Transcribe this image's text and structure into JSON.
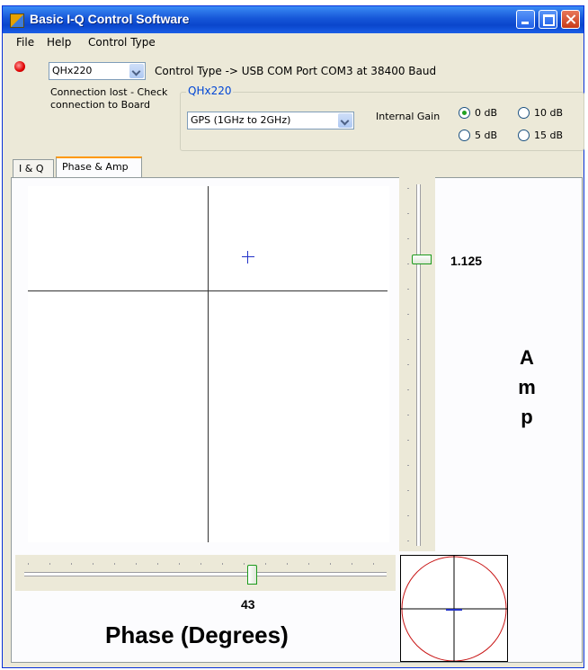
{
  "window": {
    "title": "Basic I-Q Control Software"
  },
  "menu": [
    "File",
    "Help",
    "Control Type"
  ],
  "device": {
    "selected": "QHx220",
    "control_type_text": "Control Type -> USB COM Port COM3 at 38400 Baud",
    "status_line1": "Connection lost - Check",
    "status_line2": "connection to Board",
    "status_color": "#e00000"
  },
  "group": {
    "title": "QHx220",
    "band_selected": "GPS (1GHz to 2GHz)",
    "gain_label": "Internal Gain",
    "gain_options": [
      "0 dB",
      "10 dB",
      "5 dB",
      "15 dB"
    ],
    "gain_selected": "0 dB"
  },
  "tabs": [
    "I & Q",
    "Phase & Amp"
  ],
  "active_tab": "Phase & Amp",
  "amp": {
    "value_text": "1.125",
    "letters": [
      "A",
      "m",
      "p"
    ]
  },
  "phase": {
    "value_text": "43",
    "title": "Phase (Degrees)"
  },
  "colors": {
    "marker": "#2232c8",
    "polar_circle": "#c81414",
    "slider_thumb": "#1c9a1c"
  }
}
